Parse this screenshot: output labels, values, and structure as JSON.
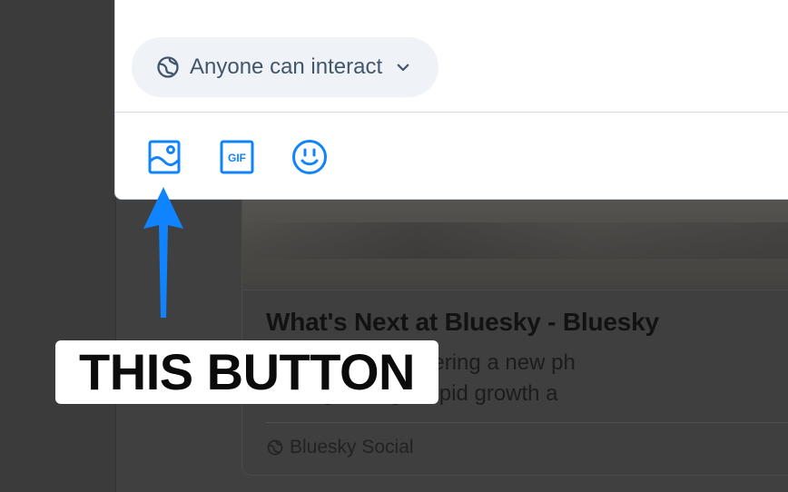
{
  "composer": {
    "interaction_setting": {
      "label": "Anyone can interact",
      "icon": "globe-icon"
    },
    "toolbar": [
      {
        "name": "image-button",
        "icon": "image-icon",
        "label": ""
      },
      {
        "name": "gif-button",
        "icon": "gif-icon",
        "label": "GIF"
      },
      {
        "name": "emoji-button",
        "icon": "emoji-icon",
        "label": ""
      }
    ],
    "accent_color": "#1083fe"
  },
  "background_post": {
    "link_card": {
      "title": "What's Next at Bluesky - Bluesky",
      "description_lines": [
        "o 2026, we're entering a new ph",
        "scaling through rapid growth a"
      ],
      "domain": "Bluesky Social"
    }
  },
  "annotation": {
    "text": "THIS BUTTON",
    "arrow_color": "#1083fe"
  }
}
